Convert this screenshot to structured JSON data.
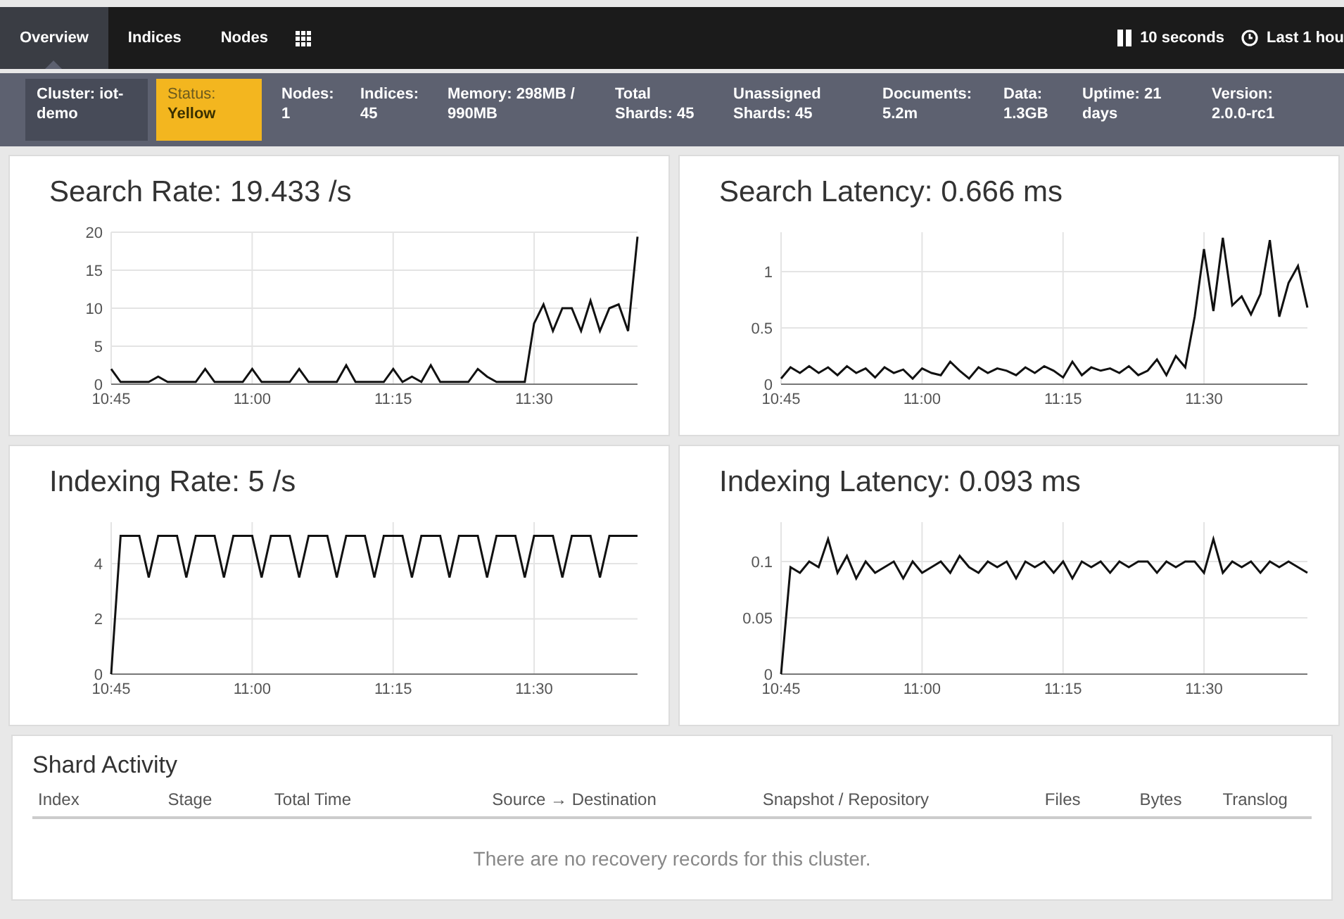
{
  "nav": {
    "tabs": [
      {
        "label": "Overview",
        "selected": true
      },
      {
        "label": "Indices",
        "selected": false
      },
      {
        "label": "Nodes",
        "selected": false
      }
    ],
    "refresh": "10 seconds",
    "range": "Last 1 hou"
  },
  "status_bar": [
    {
      "text": "Cluster: iot-demo",
      "kind": "name"
    },
    {
      "label": "Status:",
      "text": "Yellow",
      "kind": "status",
      "color": "#f3b61f"
    },
    {
      "text": "Nodes: 1",
      "kind": "stat"
    },
    {
      "text": "Indices: 45",
      "kind": "stat"
    },
    {
      "text": "Memory: 298MB / 990MB",
      "kind": "stat"
    },
    {
      "text": "Total Shards: 45",
      "kind": "stat"
    },
    {
      "text": "Unassigned Shards: 45",
      "kind": "stat"
    },
    {
      "text": "Documents: 5.2m",
      "kind": "stat"
    },
    {
      "text": "Data: 1.3GB",
      "kind": "stat"
    },
    {
      "text": "Uptime: 21 days",
      "kind": "stat"
    },
    {
      "text": "Version: 2.0.0-rc1",
      "kind": "stat"
    }
  ],
  "charts": [
    {
      "chart_data": {
        "type": "line",
        "title": "Search Rate: 19.433 /s",
        "grid": true,
        "ylim": [
          0,
          20
        ],
        "yticks": [
          0,
          5,
          10,
          15,
          20
        ],
        "categories": [
          "10:45",
          null,
          null,
          null,
          null,
          null,
          null,
          null,
          null,
          null,
          null,
          null,
          null,
          null,
          null,
          "11:00",
          null,
          null,
          null,
          null,
          null,
          null,
          null,
          null,
          null,
          null,
          null,
          null,
          null,
          null,
          "11:15",
          null,
          null,
          null,
          null,
          null,
          null,
          null,
          null,
          null,
          null,
          null,
          null,
          null,
          null,
          "11:30",
          null,
          null,
          null,
          null,
          null,
          null,
          null,
          null,
          null,
          null,
          null
        ],
        "values": [
          2,
          0.3,
          0.3,
          0.3,
          0.3,
          1,
          0.3,
          0.3,
          0.3,
          0.3,
          2,
          0.3,
          0.3,
          0.3,
          0.3,
          2,
          0.3,
          0.3,
          0.3,
          0.3,
          2,
          0.3,
          0.3,
          0.3,
          0.3,
          2.5,
          0.3,
          0.3,
          0.3,
          0.3,
          2,
          0.3,
          1,
          0.3,
          2.5,
          0.3,
          0.3,
          0.3,
          0.3,
          2,
          1,
          0.3,
          0.3,
          0.3,
          0.3,
          8,
          10.5,
          7,
          10,
          10,
          7,
          11,
          7,
          10,
          10.5,
          7,
          19.4
        ]
      }
    },
    {
      "chart_data": {
        "type": "line",
        "title": "Search Latency: 0.666 ms",
        "grid": true,
        "ylim": [
          0,
          1.35
        ],
        "yticks": [
          0,
          0.5,
          1
        ],
        "categories": [
          "10:45",
          null,
          null,
          null,
          null,
          null,
          null,
          null,
          null,
          null,
          null,
          null,
          null,
          null,
          null,
          "11:00",
          null,
          null,
          null,
          null,
          null,
          null,
          null,
          null,
          null,
          null,
          null,
          null,
          null,
          null,
          "11:15",
          null,
          null,
          null,
          null,
          null,
          null,
          null,
          null,
          null,
          null,
          null,
          null,
          null,
          null,
          "11:30",
          null,
          null,
          null,
          null,
          null,
          null,
          null,
          null,
          null,
          null,
          null
        ],
        "values": [
          0.05,
          0.15,
          0.1,
          0.16,
          0.1,
          0.15,
          0.08,
          0.16,
          0.1,
          0.14,
          0.06,
          0.15,
          0.1,
          0.13,
          0.05,
          0.14,
          0.1,
          0.08,
          0.2,
          0.12,
          0.05,
          0.15,
          0.1,
          0.14,
          0.12,
          0.08,
          0.15,
          0.1,
          0.16,
          0.12,
          0.06,
          0.2,
          0.08,
          0.15,
          0.12,
          0.14,
          0.1,
          0.16,
          0.08,
          0.12,
          0.22,
          0.08,
          0.25,
          0.15,
          0.6,
          1.2,
          0.65,
          1.3,
          0.7,
          0.78,
          0.62,
          0.8,
          1.28,
          0.6,
          0.9,
          1.05,
          0.68
        ]
      }
    },
    {
      "chart_data": {
        "type": "line",
        "title": "Indexing Rate: 5 /s",
        "grid": true,
        "ylim": [
          0,
          5.5
        ],
        "yticks": [
          0,
          2,
          4
        ],
        "categories": [
          "10:45",
          null,
          null,
          null,
          null,
          null,
          null,
          null,
          null,
          null,
          null,
          null,
          null,
          null,
          null,
          "11:00",
          null,
          null,
          null,
          null,
          null,
          null,
          null,
          null,
          null,
          null,
          null,
          null,
          null,
          null,
          "11:15",
          null,
          null,
          null,
          null,
          null,
          null,
          null,
          null,
          null,
          null,
          null,
          null,
          null,
          null,
          "11:30",
          null,
          null,
          null,
          null,
          null,
          null,
          null,
          null,
          null,
          null,
          null
        ],
        "values": [
          0,
          5,
          5,
          5,
          3.5,
          5,
          5,
          5,
          3.5,
          5,
          5,
          5,
          3.5,
          5,
          5,
          5,
          3.5,
          5,
          5,
          5,
          3.5,
          5,
          5,
          5,
          3.5,
          5,
          5,
          5,
          3.5,
          5,
          5,
          5,
          3.5,
          5,
          5,
          5,
          3.5,
          5,
          5,
          5,
          3.5,
          5,
          5,
          5,
          3.5,
          5,
          5,
          5,
          3.5,
          5,
          5,
          5,
          3.5,
          5,
          5,
          5,
          5
        ]
      }
    },
    {
      "chart_data": {
        "type": "line",
        "title": "Indexing Latency: 0.093 ms",
        "grid": true,
        "ylim": [
          0,
          0.135
        ],
        "yticks": [
          0,
          0.05,
          0.1
        ],
        "categories": [
          "10:45",
          null,
          null,
          null,
          null,
          null,
          null,
          null,
          null,
          null,
          null,
          null,
          null,
          null,
          null,
          "11:00",
          null,
          null,
          null,
          null,
          null,
          null,
          null,
          null,
          null,
          null,
          null,
          null,
          null,
          null,
          "11:15",
          null,
          null,
          null,
          null,
          null,
          null,
          null,
          null,
          null,
          null,
          null,
          null,
          null,
          null,
          "11:30",
          null,
          null,
          null,
          null,
          null,
          null,
          null,
          null,
          null,
          null,
          null
        ],
        "values": [
          0,
          0.095,
          0.09,
          0.1,
          0.095,
          0.12,
          0.09,
          0.105,
          0.085,
          0.1,
          0.09,
          0.095,
          0.1,
          0.085,
          0.1,
          0.09,
          0.095,
          0.1,
          0.09,
          0.105,
          0.095,
          0.09,
          0.1,
          0.095,
          0.1,
          0.085,
          0.1,
          0.095,
          0.1,
          0.09,
          0.1,
          0.085,
          0.1,
          0.095,
          0.1,
          0.09,
          0.1,
          0.095,
          0.1,
          0.1,
          0.09,
          0.1,
          0.095,
          0.1,
          0.1,
          0.09,
          0.12,
          0.09,
          0.1,
          0.095,
          0.1,
          0.09,
          0.1,
          0.095,
          0.1,
          0.095,
          0.09
        ]
      }
    }
  ],
  "shard_activity": {
    "title": "Shard Activity",
    "columns": [
      "Index",
      "Stage",
      "Total Time",
      "Source → Destination",
      "Snapshot / Repository",
      "Files",
      "Bytes",
      "Translog"
    ],
    "empty_message": "There are no recovery records for this cluster."
  }
}
